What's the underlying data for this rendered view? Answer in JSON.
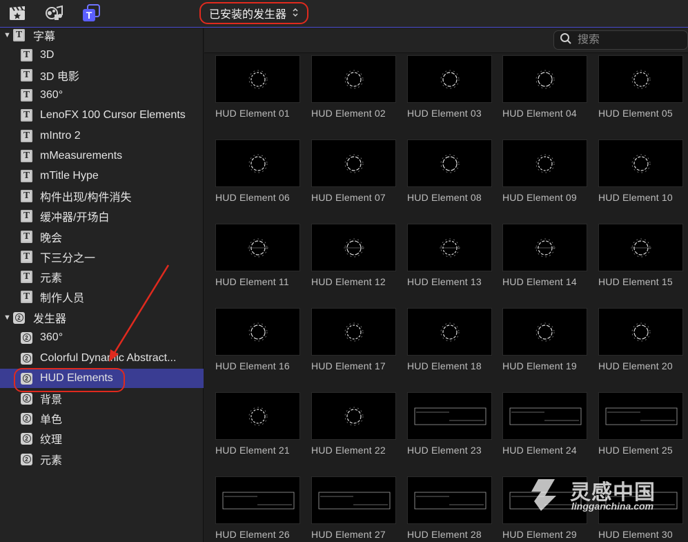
{
  "toolbar": {
    "icons": [
      "clapperboard-icon",
      "photos-music-icon",
      "titles-generators-icon"
    ],
    "selector_label": "已安装的发生器",
    "selector_arrows": "⌃⌄"
  },
  "sidebar": {
    "categories": [
      {
        "label": "字幕",
        "icon": "title-T-icon",
        "expanded": true,
        "items": [
          "3D",
          "3D 电影",
          "360°",
          "LenoFX 100 Cursor Elements",
          "mIntro 2",
          "mMeasurements",
          "mTitle Hype",
          "构件出现/构件消失",
          "缓冲器/开场白",
          "晚会",
          "下三分之一",
          "元素",
          "制作人员"
        ]
      },
      {
        "label": "发生器",
        "icon": "generator-icon",
        "expanded": true,
        "items": [
          "360°",
          "Colorful Dynamic Abstract...",
          "HUD Elements",
          "背景",
          "单色",
          "纹理",
          "元素"
        ],
        "selected": "HUD Elements"
      }
    ]
  },
  "search": {
    "placeholder": "搜索",
    "value": ""
  },
  "grid": {
    "items": [
      "HUD Element 01",
      "HUD Element 02",
      "HUD Element 03",
      "HUD Element 04",
      "HUD Element 05",
      "HUD Element 06",
      "HUD Element 07",
      "HUD Element 08",
      "HUD Element 09",
      "HUD Element 10",
      "HUD Element 11",
      "HUD Element 12",
      "HUD Element 13",
      "HUD Element 14",
      "HUD Element 15",
      "HUD Element 16",
      "HUD Element 17",
      "HUD Element 18",
      "HUD Element 19",
      "HUD Element 20",
      "HUD Element 21",
      "HUD Element 22",
      "HUD Element 23",
      "HUD Element 24",
      "HUD Element 25",
      "HUD Element 26",
      "HUD Element 27",
      "HUD Element 28",
      "HUD Element 29",
      "HUD Element 30"
    ]
  },
  "watermark": {
    "title": "灵感中国",
    "subtitle": "lingganchina.com"
  },
  "colors": {
    "accent": "#3a3d93",
    "highlight": "#e02a1e",
    "topline": "#4a4cd0"
  }
}
